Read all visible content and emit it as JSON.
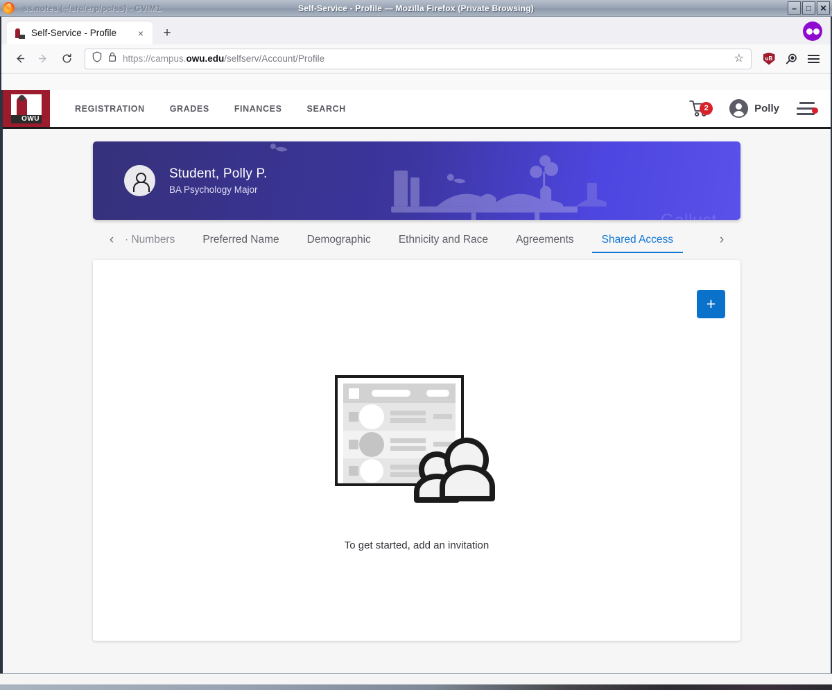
{
  "window": {
    "inactive_title": "ss.notes (~/src/erp/pc/ss) - GVIM1",
    "active_title": "Self-Service - Profile — Mozilla Firefox (Private Browsing)",
    "minimize_label": "–",
    "maximize_label": "□",
    "close_label": "✕"
  },
  "browser": {
    "tab": {
      "title": "Self-Service - Profile",
      "close_label": "×"
    },
    "new_tab_label": "+",
    "nav": {
      "back_label": "←",
      "forward_label": "→",
      "reload_label": "↻"
    },
    "url": {
      "scheme": "https://campus.",
      "domain": "owu.edu",
      "path": "/selfserv/Account/Profile",
      "bookmark_label": "☆"
    },
    "extensions": {
      "ublock_label": "uB",
      "second_ext_name": "extension-icon"
    },
    "private_badge_name": "private-browsing-mask-icon"
  },
  "app": {
    "logo_text": "OWU",
    "nav_items": [
      {
        "label": "REGISTRATION"
      },
      {
        "label": "GRADES"
      },
      {
        "label": "FINANCES"
      },
      {
        "label": "SEARCH"
      }
    ],
    "cart_badge": "2",
    "user_name": "Polly"
  },
  "banner": {
    "name": "Student, Polly P.",
    "subtitle": "BA Psychology Major",
    "watermark": "Gallust",
    "gradient_start": "#36317a",
    "gradient_end": "#5a50ea"
  },
  "profile_tabs": {
    "prev_label": "‹",
    "next_label": "›",
    "items": [
      {
        "label": "· Numbers",
        "active": false
      },
      {
        "label": "Preferred Name",
        "active": false
      },
      {
        "label": "Demographic",
        "active": false
      },
      {
        "label": "Ethnicity and Race",
        "active": false
      },
      {
        "label": "Agreements",
        "active": false
      },
      {
        "label": "Shared Access",
        "active": true
      }
    ],
    "active_color": "#1076d4"
  },
  "shared_access": {
    "add_button_label": "+",
    "add_button_color": "#0b72cc",
    "empty_message": "To get started, add an invitation"
  }
}
